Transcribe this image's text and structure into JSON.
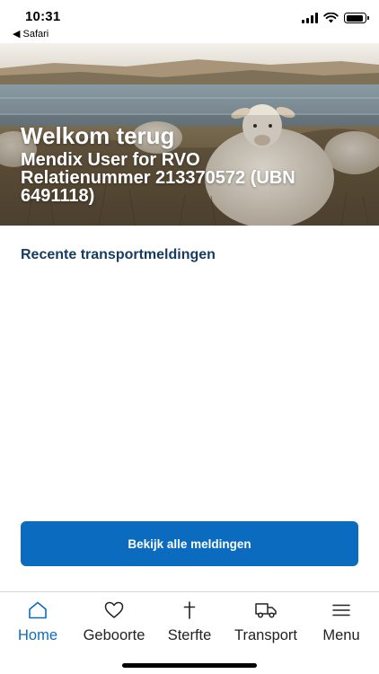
{
  "status_bar": {
    "time": "10:31",
    "back_app": "◀ Safari",
    "battery_level": 0.9
  },
  "hero": {
    "title": "Welkom terug",
    "user": "Mendix User for RVO",
    "relation": "Relatienummer 213370572 (UBN 6491118)"
  },
  "main": {
    "section_heading": "Recente transportmeldingen",
    "view_all_button": "Bekijk alle meldingen"
  },
  "tabs": [
    {
      "label": "Home",
      "icon": "home-icon",
      "active": true
    },
    {
      "label": "Geboorte",
      "icon": "heart-icon",
      "active": false
    },
    {
      "label": "Sterfte",
      "icon": "cross-icon",
      "active": false
    },
    {
      "label": "Transport",
      "icon": "truck-icon",
      "active": false
    },
    {
      "label": "Menu",
      "icon": "hamburger-icon",
      "active": false
    }
  ],
  "colors": {
    "accent": "#0b6bbf",
    "heading": "#173b5f"
  }
}
